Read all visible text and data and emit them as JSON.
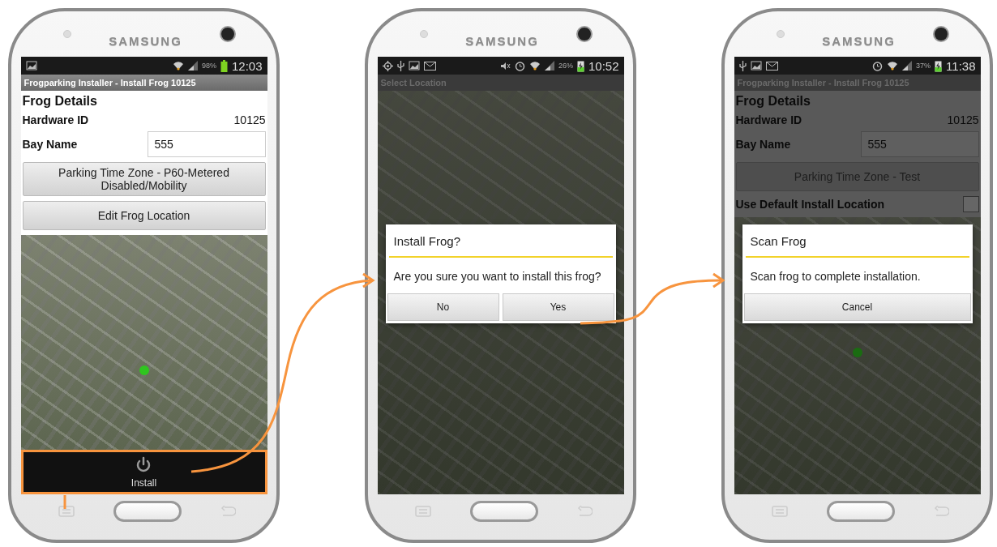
{
  "phones": [
    {
      "brand": "SAMSUNG",
      "status_bar": {
        "notification_icons": [
          {
            "kind": "image"
          }
        ],
        "system_icons": [
          {
            "kind": "wifi"
          },
          {
            "kind": "signal"
          }
        ],
        "battery": "98%",
        "charging": false,
        "time": "12:03"
      },
      "title_bar": "Frogparking Installer - Install Frog 10125",
      "dimmed": false,
      "content": [
        {
          "kind": "heading",
          "label": "Frog Details"
        },
        {
          "kind": "field_row",
          "label": "Hardware ID",
          "value": "10125"
        },
        {
          "kind": "input_row",
          "label": "Bay Name",
          "value": "555"
        },
        {
          "kind": "button",
          "label": "Parking Time Zone - P60-Metered Disabled/Mobility"
        },
        {
          "kind": "button",
          "label": "Edit Frog Location"
        },
        {
          "kind": "map",
          "marker": true
        }
      ],
      "action_bar": {
        "label": "Install",
        "highlighted": true
      }
    },
    {
      "brand": "SAMSUNG",
      "status_bar": {
        "notification_icons": [
          {
            "kind": "gps"
          },
          {
            "kind": "usb"
          },
          {
            "kind": "image"
          },
          {
            "kind": "mail"
          }
        ],
        "system_icons": [
          {
            "kind": "mute"
          },
          {
            "kind": "alarm"
          },
          {
            "kind": "wifi"
          },
          {
            "kind": "signal"
          }
        ],
        "battery": "26%",
        "charging": true,
        "time": "10:52"
      },
      "title_bar": "Select Location",
      "dimmed": true,
      "content": [
        {
          "kind": "map",
          "marker": false
        }
      ],
      "dialog": {
        "title": "Install Frog?",
        "message": "Are you sure you want to install this frog?",
        "buttons": [
          "No",
          "Yes"
        ]
      }
    },
    {
      "brand": "SAMSUNG",
      "status_bar": {
        "notification_icons": [
          {
            "kind": "usb"
          },
          {
            "kind": "image"
          },
          {
            "kind": "mail"
          }
        ],
        "system_icons": [
          {
            "kind": "alarm"
          },
          {
            "kind": "wifi"
          },
          {
            "kind": "signal"
          }
        ],
        "battery": "37%",
        "charging": true,
        "time": "11:38"
      },
      "title_bar": "Frogparking Installer - Install Frog 10125",
      "dimmed": true,
      "content": [
        {
          "kind": "heading",
          "label": "Frog Details"
        },
        {
          "kind": "field_row",
          "label": "Hardware ID",
          "value": "10125"
        },
        {
          "kind": "input_row",
          "label": "Bay Name",
          "value": "555"
        },
        {
          "kind": "button",
          "label": "Parking Time Zone - Test"
        },
        {
          "kind": "checkbox_row",
          "label": "Use Default Install Location",
          "checked": false
        },
        {
          "kind": "map",
          "marker": true
        }
      ],
      "dialog": {
        "title": "Scan Frog",
        "message": "Scan frog to complete installation.",
        "buttons": [
          "Cancel"
        ]
      }
    }
  ]
}
